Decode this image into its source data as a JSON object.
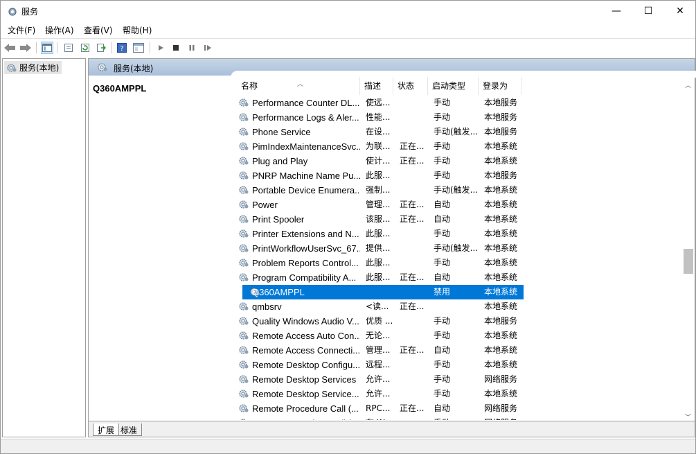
{
  "window": {
    "title": "服务",
    "minimize_label": "—",
    "maximize_label": "☐",
    "close_label": "✕"
  },
  "menu": {
    "items": [
      "文件(F)",
      "操作(A)",
      "查看(V)",
      "帮助(H)"
    ]
  },
  "toolbar": {
    "icons": [
      "back-icon",
      "forward-icon",
      "console-tree-icon",
      "properties-icon",
      "refresh-icon",
      "export-list-icon",
      "help-icon",
      "help-view-icon",
      "start-service-icon",
      "stop-service-icon",
      "pause-service-icon",
      "restart-service-icon"
    ]
  },
  "tree": {
    "root_label": "服务(本地)"
  },
  "panel": {
    "header_title": "服务(本地)",
    "selected_service_name": "Q360AMPPL"
  },
  "table": {
    "columns": [
      "名称",
      "描述",
      "状态",
      "启动类型",
      "登录为"
    ],
    "rows": [
      {
        "name": "Performance Counter DL...",
        "desc": "使远...",
        "status": "",
        "start": "手动",
        "logon": "本地服务"
      },
      {
        "name": "Performance Logs & Aler...",
        "desc": "性能...",
        "status": "",
        "start": "手动",
        "logon": "本地服务"
      },
      {
        "name": "Phone Service",
        "desc": "在设...",
        "status": "",
        "start": "手动(触发...",
        "logon": "本地服务"
      },
      {
        "name": "PimIndexMaintenanceSvc...",
        "desc": "为联...",
        "status": "正在...",
        "start": "手动",
        "logon": "本地系统"
      },
      {
        "name": "Plug and Play",
        "desc": "使计...",
        "status": "正在...",
        "start": "手动",
        "logon": "本地系统"
      },
      {
        "name": "PNRP Machine Name Pu...",
        "desc": "此服...",
        "status": "",
        "start": "手动",
        "logon": "本地服务"
      },
      {
        "name": "Portable Device Enumera...",
        "desc": "强制...",
        "status": "",
        "start": "手动(触发...",
        "logon": "本地系统"
      },
      {
        "name": "Power",
        "desc": "管理...",
        "status": "正在...",
        "start": "自动",
        "logon": "本地系统"
      },
      {
        "name": "Print Spooler",
        "desc": "该服...",
        "status": "正在...",
        "start": "自动",
        "logon": "本地系统"
      },
      {
        "name": "Printer Extensions and N...",
        "desc": "此服...",
        "status": "",
        "start": "手动",
        "logon": "本地系统"
      },
      {
        "name": "PrintWorkflowUserSvc_67...",
        "desc": "提供...",
        "status": "",
        "start": "手动(触发...",
        "logon": "本地系统"
      },
      {
        "name": "Problem Reports Control...",
        "desc": "此服...",
        "status": "",
        "start": "手动",
        "logon": "本地系统"
      },
      {
        "name": "Program Compatibility A...",
        "desc": "此服...",
        "status": "正在...",
        "start": "自动",
        "logon": "本地系统"
      },
      {
        "name": "Q360AMPPL",
        "desc": "",
        "status": "",
        "start": "禁用",
        "logon": "本地系统",
        "selected": true
      },
      {
        "name": "qmbsrv",
        "desc": "<读...",
        "status": "正在...",
        "start": "",
        "logon": "本地系统"
      },
      {
        "name": "Quality Windows Audio V...",
        "desc": "优质 ...",
        "status": "",
        "start": "手动",
        "logon": "本地服务"
      },
      {
        "name": "Remote Access Auto Con...",
        "desc": "无论...",
        "status": "",
        "start": "手动",
        "logon": "本地系统"
      },
      {
        "name": "Remote Access Connecti...",
        "desc": "管理...",
        "status": "正在...",
        "start": "自动",
        "logon": "本地系统"
      },
      {
        "name": "Remote Desktop Configu...",
        "desc": "远程...",
        "status": "",
        "start": "手动",
        "logon": "本地系统"
      },
      {
        "name": "Remote Desktop Services",
        "desc": "允许...",
        "status": "",
        "start": "手动",
        "logon": "网络服务"
      },
      {
        "name": "Remote Desktop Service...",
        "desc": "允许...",
        "status": "",
        "start": "手动",
        "logon": "本地系统"
      },
      {
        "name": "Remote Procedure Call (...",
        "desc": "RPC...",
        "status": "正在...",
        "start": "自动",
        "logon": "网络服务"
      },
      {
        "name": "Remote Procedure Call (...",
        "desc": "在 W...",
        "status": "",
        "start": "手动",
        "logon": "网络服务"
      }
    ]
  },
  "tabs": {
    "extended": "扩展",
    "standard": "标准"
  }
}
